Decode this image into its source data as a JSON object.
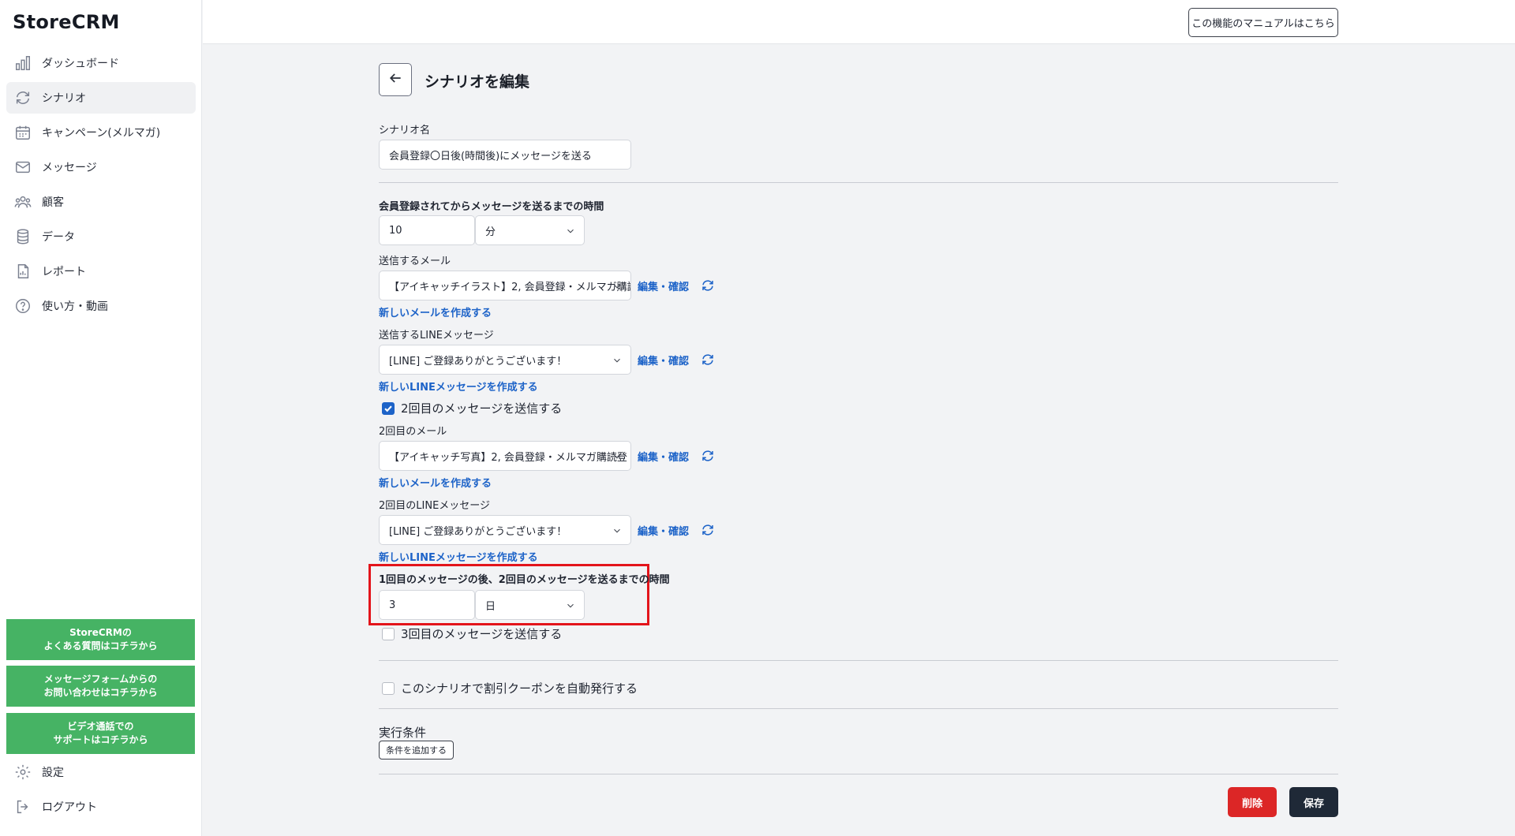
{
  "app": {
    "logo": "StoreCRM"
  },
  "sidebar": {
    "items": [
      {
        "label": "ダッシュボード",
        "icon": "bar-chart-icon"
      },
      {
        "label": "シナリオ",
        "icon": "refresh-cycle-icon",
        "active": true
      },
      {
        "label": "キャンペーン(メルマガ)",
        "icon": "calendar-icon"
      },
      {
        "label": "メッセージ",
        "icon": "mail-icon"
      },
      {
        "label": "顧客",
        "icon": "users-icon"
      },
      {
        "label": "データ",
        "icon": "database-icon"
      },
      {
        "label": "レポート",
        "icon": "file-report-icon"
      },
      {
        "label": "使い方・動画",
        "icon": "question-icon"
      }
    ],
    "help_buttons": [
      {
        "line1": "StoreCRMの",
        "line2": "よくある質問はコチラから"
      },
      {
        "line1": "メッセージフォームからの",
        "line2": "お問い合わせはコチラから"
      },
      {
        "line1": "ビデオ通話での",
        "line2": "サポートはコチラから"
      }
    ],
    "settings_label": "設定",
    "logout_label": "ログアウト"
  },
  "header": {
    "manual_button": "この機能のマニュアルはこちら"
  },
  "page": {
    "title": "シナリオを編集"
  },
  "form": {
    "scenario_name_label": "シナリオ名",
    "scenario_name_value": "会員登録〇日後(時間後)にメッセージを送る",
    "delay_label": "会員登録されてからメッセージを送るまでの時間",
    "delay_value": "10",
    "delay_unit": "分",
    "mail_label": "送信するメール",
    "mail_value": "【アイキャッチイラスト】2, 会員登録・メルマガ購読:",
    "edit_confirm": "編集・確認",
    "new_mail_link": "新しいメールを作成する",
    "line_label": "送信するLINEメッセージ",
    "line_value": "[LINE] ご登録ありがとうございます！",
    "new_line_link": "新しいLINEメッセージを作成する",
    "second_send_label": "2回目のメッセージを送信する",
    "second_send_checked": true,
    "second_mail_label": "2回目のメール",
    "second_mail_value": "【アイキャッチ写真】2, 会員登録・メルマガ購読登",
    "second_line_label": "2回目のLINEメッセージ",
    "second_line_value": "[LINE] ご登録ありがとうございます！",
    "second_delay_label": "1回目のメッセージの後、2回目のメッセージを送るまでの時間",
    "second_delay_value": "3",
    "second_delay_unit": "日",
    "third_send_label": "3回目のメッセージを送信する",
    "third_send_checked": false,
    "coupon_label": "このシナリオで割引クーポンを自動発行する",
    "coupon_checked": false,
    "conditions_label": "実行条件",
    "add_condition_button": "条件を追加する",
    "delete_button": "削除",
    "save_button": "保存"
  },
  "colors": {
    "accent_blue": "#1d63c8",
    "help_green": "#46b364",
    "delete_red": "#dc2626",
    "save_dark": "#1f2937",
    "highlight_red": "#e3141b"
  }
}
